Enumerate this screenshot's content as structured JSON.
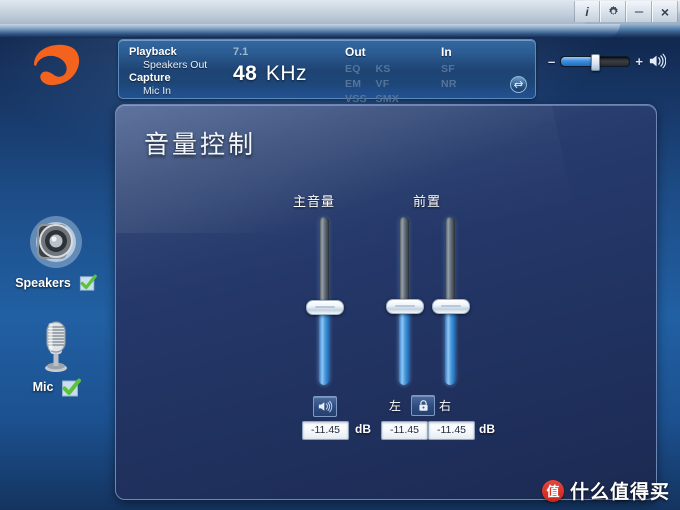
{
  "window": {
    "titlebar_buttons": [
      {
        "name": "info-button",
        "label": "i"
      },
      {
        "name": "settings-button",
        "label": "gear-icon"
      },
      {
        "name": "minimize-button",
        "label": "–"
      },
      {
        "name": "close-button",
        "label": "×"
      }
    ]
  },
  "brand": {
    "logo_name": "realtek-logo"
  },
  "info_panel": {
    "playback_label": "Playback",
    "playback_device": "Speakers Out",
    "capture_label": "Capture",
    "capture_device": "Mic In",
    "channel_config": "7.1",
    "sample_rate_value": "48",
    "sample_rate_unit": "KHz",
    "out_label": "Out",
    "out_effects_row1": [
      "EQ",
      "KS"
    ],
    "out_effects_row2": [
      "EM",
      "VF"
    ],
    "out_effects_row3": [
      "VSS",
      "SMX"
    ],
    "in_label": "In",
    "in_effects_row1": [
      "SF"
    ],
    "in_effects_row2": [
      "NR"
    ],
    "swap_icon": "swap-arrows-icon"
  },
  "master_volume": {
    "minus_label": "–",
    "plus_label": "+",
    "level_percent": 45,
    "speaker_icon": "speaker-icon"
  },
  "devices": [
    {
      "name": "Speakers",
      "icon": "speaker-device-icon",
      "enabled": true,
      "check_icon": "green-check-icon"
    },
    {
      "name": "Mic",
      "icon": "microphone-device-icon",
      "enabled": true,
      "check_icon": "green-check-icon"
    }
  ],
  "main": {
    "title": "音量控制",
    "groups": [
      {
        "key": "master",
        "title": "主音量",
        "sliders": [
          {
            "key": "master",
            "value_percent": 47,
            "value_text": "-11.45"
          }
        ],
        "mute_icon": "speaker-mute-icon",
        "unit": "dB"
      },
      {
        "key": "front",
        "title": "前置",
        "sliders": [
          {
            "key": "left",
            "value_percent": 48,
            "value_text": "-11.45"
          },
          {
            "key": "right",
            "value_percent": 48,
            "value_text": "-11.45"
          }
        ],
        "left_label": "左",
        "right_label": "右",
        "lock_icon": "lock-icon",
        "unit": "dB"
      }
    ]
  },
  "watermark": {
    "badge": "值",
    "text": "什么值得买"
  },
  "colors": {
    "accent_blue": "#3f8ede",
    "brand_orange": "#f4631e",
    "panel_blue": "#223463",
    "check_green": "#5cc23a",
    "watermark_red": "#c9261d"
  }
}
